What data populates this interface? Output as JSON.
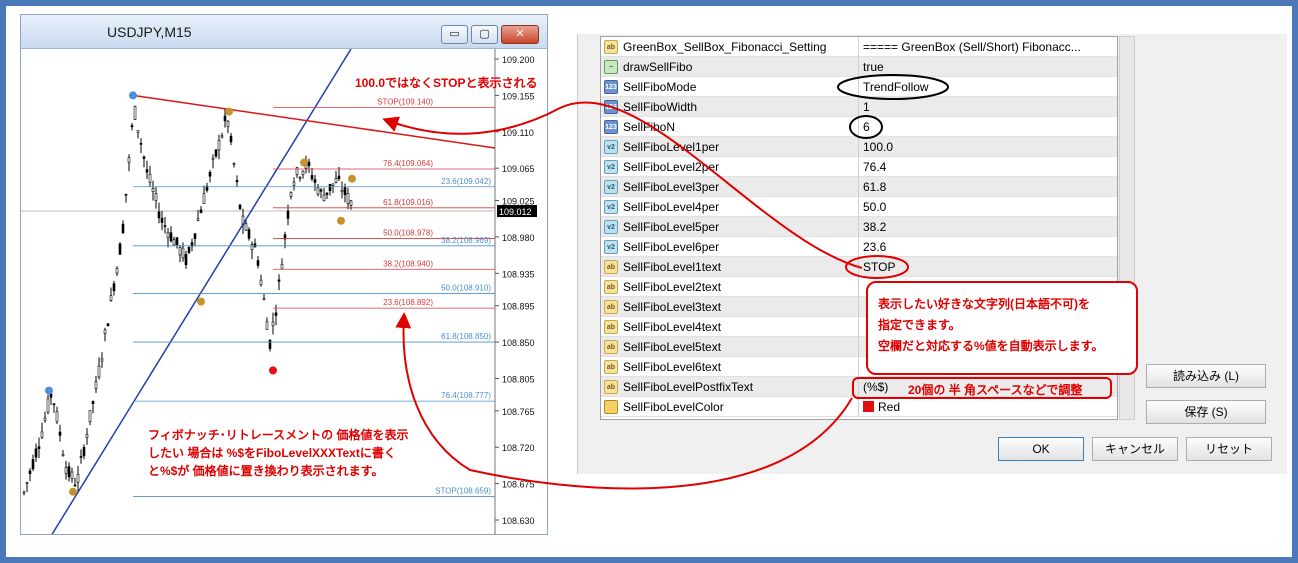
{
  "chart": {
    "title": "USDJPY,M15",
    "buttons": {
      "minimize": "▭",
      "maximize": "▢",
      "close": "✕"
    },
    "price_labels": [
      "109.200",
      "109.155",
      "109.110",
      "109.065",
      "109.025",
      "108.980",
      "108.935",
      "108.895",
      "108.850",
      "108.805",
      "108.765",
      "108.720",
      "108.675",
      "108.630"
    ],
    "current_price": "109.012",
    "fibo_red": [
      "STOP(109.140)",
      "76.4(109.064)",
      "61.8(109.016)",
      "50.0(108.978)",
      "38.2(108.940)",
      "23.6(108.892)"
    ],
    "fibo_blue": [
      "23.6(109.042)",
      "38.2(108.969)",
      "50.0(108.910)",
      "61.8(108.850)",
      "76.4(108.777)",
      "STOP(108.659)"
    ],
    "colors": {
      "up_trend": "#1f3fae",
      "down_trend": "#d81818",
      "fibo_red": "#d83a3a",
      "fibo_blue": "#4a8fd0",
      "candle": "#000000"
    }
  },
  "dialog": {
    "rows": [
      {
        "icon": "ab",
        "name": "GreenBox_SellBox_Fibonacci_Setting",
        "value": "===== GreenBox (Sell/Short) Fibonacc..."
      },
      {
        "icon": "bool",
        "name": "drawSellFibo",
        "value": "true"
      },
      {
        "icon": "n123",
        "name": "SellFiboMode",
        "value": "TrendFollow"
      },
      {
        "icon": "n123",
        "name": "SellFiboWidth",
        "value": "1"
      },
      {
        "icon": "n123",
        "name": "SellFiboN",
        "value": "6"
      },
      {
        "icon": "v2",
        "name": "SellFiboLevel1per",
        "value": "100.0"
      },
      {
        "icon": "v2",
        "name": "SellFiboLevel2per",
        "value": "76.4"
      },
      {
        "icon": "v2",
        "name": "SellFiboLevel3per",
        "value": "61.8"
      },
      {
        "icon": "v2",
        "name": "SellFiboLevel4per",
        "value": "50.0"
      },
      {
        "icon": "v2",
        "name": "SellFiboLevel5per",
        "value": "38.2"
      },
      {
        "icon": "v2",
        "name": "SellFiboLevel6per",
        "value": "23.6"
      },
      {
        "icon": "ab",
        "name": "SellFiboLevel1text",
        "value": "STOP"
      },
      {
        "icon": "ab",
        "name": "SellFiboLevel2text",
        "value": ""
      },
      {
        "icon": "ab",
        "name": "SellFiboLevel3text",
        "value": ""
      },
      {
        "icon": "ab",
        "name": "SellFiboLevel4text",
        "value": ""
      },
      {
        "icon": "ab",
        "name": "SellFiboLevel5text",
        "value": ""
      },
      {
        "icon": "ab",
        "name": "SellFiboLevel6text",
        "value": ""
      },
      {
        "icon": "ab",
        "name": "SellFiboLevelPostfixText",
        "value": "(%$)"
      },
      {
        "icon": "clr",
        "name": "SellFiboLevelColor",
        "value": "Red",
        "color": "#e01010"
      }
    ],
    "buttons": {
      "load": "読み込み (L)",
      "save": "保存 (S)",
      "ok": "OK",
      "cancel": "キャンセル",
      "reset": "リセット"
    }
  },
  "annotations": {
    "stop_note": "100.0ではなくSTOPと表示される",
    "text_note": [
      "表示したい好きな文字列(日本語不可)を",
      "指定できます。",
      "空欄だと対応する%値を自動表示します。"
    ],
    "postfix_note": "20個の 半 角スペースなどで調整",
    "price_note": [
      "フィボナッチ･リトレースメントの 価格値を表示",
      "したい 場合は %$をFiboLevelXXXTextに書く",
      "と%$が 価格値に置き換わり表示されます。"
    ],
    "color": "#e00000"
  }
}
